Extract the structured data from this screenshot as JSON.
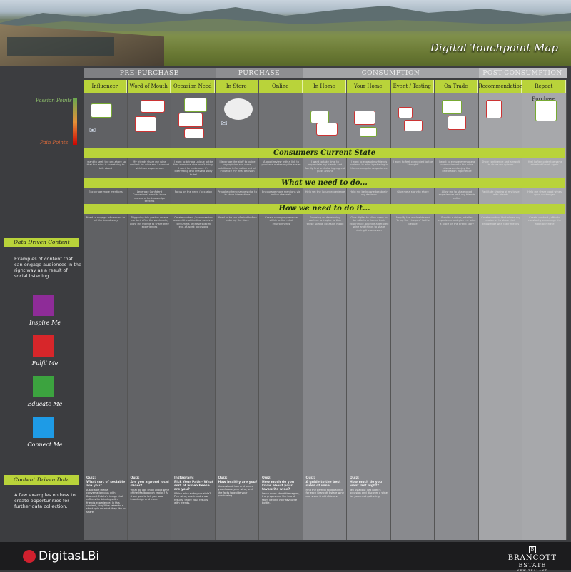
{
  "header": {
    "title": "Digital Touchpoint Map"
  },
  "phases": [
    {
      "label": "PRE-PURCHASE",
      "bg": "#7f8083",
      "width": 184.5
    },
    {
      "label": "PURCHASE",
      "bg": "#8d8e91",
      "width": 123
    },
    {
      "label": "CONSUMPTION",
      "bg": "#a3a4a7",
      "width": 246
    },
    {
      "label": "POST-CONSUMPTION",
      "bg": "#bdbec0",
      "width": 123
    }
  ],
  "columns": [
    {
      "label": "Influencer",
      "bg": "#606164"
    },
    {
      "label": "Word of Mouth",
      "bg": "#626366"
    },
    {
      "label": "Occasion Need",
      "bg": "#646568"
    },
    {
      "label": "In Store",
      "bg": "#6e6f72"
    },
    {
      "label": "Online",
      "bg": "#707174"
    },
    {
      "label": "In Home",
      "bg": "#85868a"
    },
    {
      "label": "Your Home",
      "bg": "#87888c"
    },
    {
      "label": "Event / Tasting",
      "bg": "#898a8e"
    },
    {
      "label": "On Trade",
      "bg": "#8b8c90"
    },
    {
      "label": "Recommendation",
      "bg": "#a4a5a8"
    },
    {
      "label": "Repeat Purchase",
      "bg": "#a7a8ab"
    }
  ],
  "left": {
    "passion": "Passion Points",
    "pain": "Pain Points",
    "data_driven": "Data Driven Content",
    "data_desc": "Examples of content that can engage audiences in the right way as a result of social listening.",
    "content_driven": "Content Driven Data",
    "content_desc": "A few examples on how to create opportunities for further data collection."
  },
  "swatches": [
    {
      "label": "Inspire Me",
      "color": "#8e2c98"
    },
    {
      "label": "Fulfil Me",
      "color": "#d7262a"
    },
    {
      "label": "Educate Me",
      "color": "#3ca33f"
    },
    {
      "label": "Connect Me",
      "color": "#1e9be6"
    }
  ],
  "banners": [
    "Consumers Current State",
    "What we need to do...",
    "How we need to do it..."
  ],
  "state": [
    "I want to seek the pre-share so that the wine is something to talk about",
    "My friends share my wine content for wine and I connect with their experiences",
    "I want to bring a unique bottle that someone else won't bring. I want to make sure it's interesting and I have a story to tell",
    "I leverage the staff to guide my opinion and more additional information but let influence my final decision",
    "A good review with a link to purchase makes my life easier",
    "I want to take time to appreciate my friends and family first and sharing a great glass around",
    "I want to expand my friends horizons in wine by sharing in the consumption experience",
    "I want to feel connected to the 'thought'",
    "I want to ensure everyone a connection with the wine discovered enjoy the celebration experience",
    "Show confidence and a result to share my opinion",
    "I feel I often order the same wine but I'm ok again"
  ],
  "need": [
    "Encourage more mentions",
    "Leverage Confident Connectors' need to know more and be knowledge seekers",
    "Focus on the need / occasion",
    "Provoke other channels due to in-store interactions",
    "Encourage more mentions via online channels",
    "Help set the luxury experience",
    "Help me be knowledgeable in my decision",
    "Give me a story to share",
    "Allow me to share good experiences with my friends online",
    "Facilitate sharing of my taste with friends",
    "Help me share good wines upon unchanged"
  ],
  "how": [
    "Need to engage influencers to tell the brand story",
    "Triggering this post or create content after the weekends, allow my friends to share their experiences",
    "Create content / conversation around the attitudinal needs of consumers of these specific end-of-week occasions",
    "Need to be top of mind before entering the store",
    "Create stronger presence within online retail environments",
    "Focusing on developing content to inspire further those special occasion mood",
    "Give digital to allow users to be able to enhance their experience, provide a detailed wine and things to share during the occasion",
    "Amplify the worldwide and 'bring the vineyard' to the people",
    "Provide a richer, retailer experience and give my wine a place on the brand story",
    "Create content that allows my customer to share their knowledge with their friends",
    "Create content / offer to constantly encourage the habit purchase"
  ],
  "quizzes": [
    {
      "t1": "Quiz:",
      "t2": "What sort of sociable are you?",
      "body": "A sociable media conversation plus with Brancott Estate's image that reflects its drinking-with-friends experience. In this content, they'll be taken to a short quiz on what they like to share."
    },
    {
      "t1": "Quiz:",
      "t2": "Are you a proud local slider?",
      "body": "What do you know about wine of the Marlborough region? A short quiz to tell you local knowledge and more."
    },
    {
      "t1": "Instagram:",
      "t2": "Pick Your Path - What sort of wine/cheese are you?",
      "body": "Which wine suits your style? Pick wine, snack and show results. Share your results with friends."
    },
    {
      "t1": "Quiz:",
      "t2": "How healthy are you?",
      "body": "Understand how and where you choose your wine, and the facts to guide your purchasing."
    },
    {
      "t1": "Quiz:",
      "t2": "How much do you know about your favourite wine?",
      "body": "Learn more about the region, the grapes and the brand story behind your favourite bottle."
    },
    {
      "t1": "Quiz:",
      "t2": "A guide to the best sides of wine",
      "body": "Find the perfect food pairing for each Brancott Estate wine and share it with friends."
    },
    {
      "t1": "Quiz:",
      "t2": "How much do you want last night?",
      "body": "Tell us about last night's occasion and discover a wine for your next gathering."
    }
  ],
  "footer": {
    "agency": "DigitasLBi",
    "brand": "BRANCOTT",
    "brand2": "ESTATE",
    "brand3": "NEW ZEALAND",
    "brandmark": "B"
  }
}
